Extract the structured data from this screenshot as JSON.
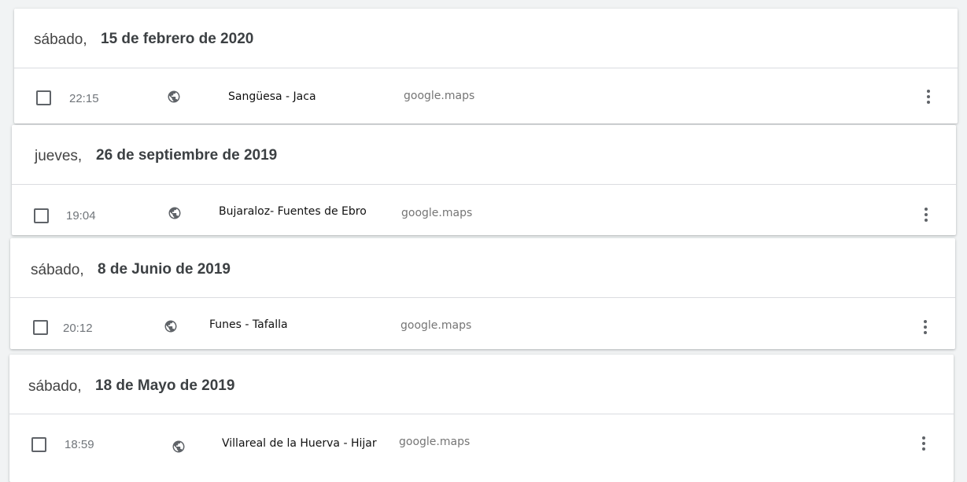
{
  "entries": [
    {
      "weekday": "sábado,",
      "date": "15 de febrero de 2020",
      "time": "22:15",
      "title": "Sangüesa - Jaca",
      "source": "google.maps",
      "icon": "globe-icon"
    },
    {
      "weekday": "jueves,",
      "date": "26 de septiembre de 2019",
      "time": "19:04",
      "title": "Bujaraloz- Fuentes de Ebro",
      "source": "google.maps",
      "icon": "globe-icon"
    },
    {
      "weekday": "sábado,",
      "date": "8 de Junio de 2019",
      "time": "20:12",
      "title": "Funes - Tafalla",
      "source": "google.maps",
      "icon": "globe-icon"
    },
    {
      "weekday": "sábado,",
      "date": "18 de Mayo de 2019",
      "time": "18:59",
      "title": "Villareal de la Huerva - Hijar",
      "source": "google.maps",
      "icon": "globe-icon"
    }
  ],
  "colors": {
    "text": "#3c4043",
    "muted": "#70757a",
    "divider": "#dadce0"
  }
}
